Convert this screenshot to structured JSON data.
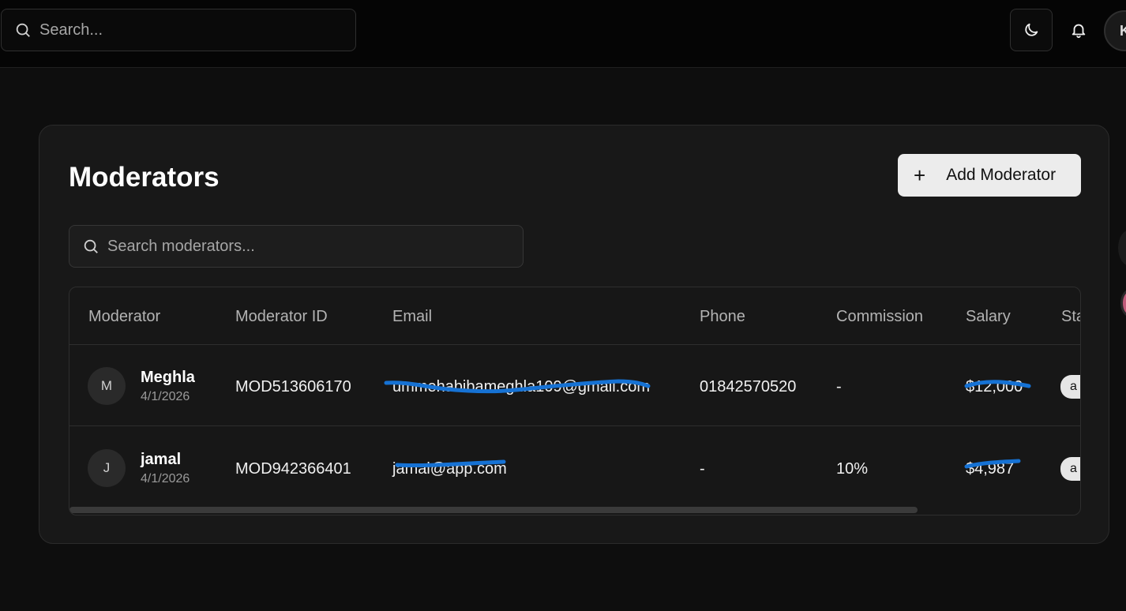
{
  "topbar": {
    "search_placeholder": "Search...",
    "avatar_initial": "K"
  },
  "page": {
    "title": "Moderators",
    "add_button_label": "Add Moderator",
    "search_placeholder": "Search moderators..."
  },
  "table": {
    "columns": [
      "Moderator",
      "Moderator ID",
      "Email",
      "Phone",
      "Commission",
      "Salary",
      "Sta"
    ],
    "rows": [
      {
        "initial": "M",
        "name": "Meghla",
        "date": "4/1/2026",
        "id": "MOD513606170",
        "email": "ummehabibameghla109@gmail.com",
        "phone": "01842570520",
        "commission": "-",
        "salary": "$12,000",
        "status": "a"
      },
      {
        "initial": "J",
        "name": "jamal",
        "date": "4/1/2026",
        "id": "MOD942366401",
        "email": "jamal@app.com",
        "phone": "-",
        "commission": "10%",
        "salary": "$4,987",
        "status": "a"
      }
    ]
  },
  "colors": {
    "redaction_scribble": "#1672d4"
  }
}
